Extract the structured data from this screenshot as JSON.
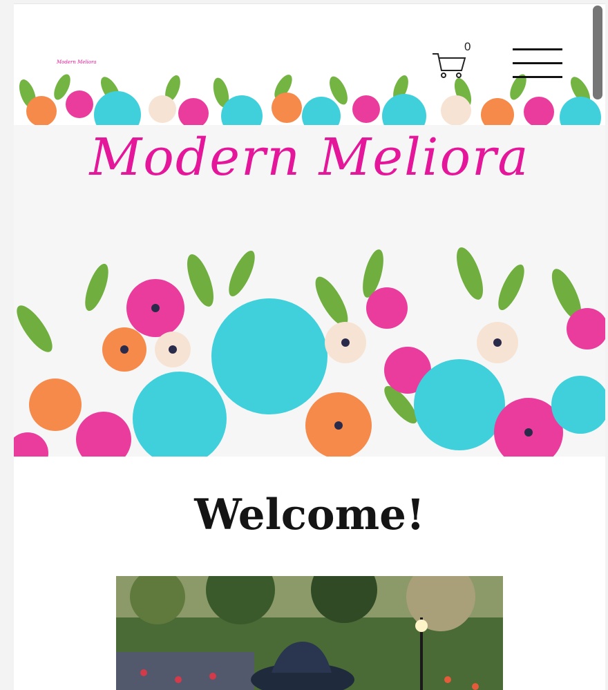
{
  "brand": {
    "mini_logo": "Modern Meliora",
    "hero_logo": "Modern Meliora"
  },
  "cart": {
    "count": "0",
    "icon": "shopping-cart-icon"
  },
  "menu": {
    "icon": "hamburger-menu-icon"
  },
  "main": {
    "heading": "Welcome!"
  },
  "colors": {
    "brand_pink": "#e4169a",
    "turquoise": "#3fd0dc",
    "orange": "#f58a4b",
    "leaf_green": "#6fae3f",
    "background": "#ffffff"
  }
}
